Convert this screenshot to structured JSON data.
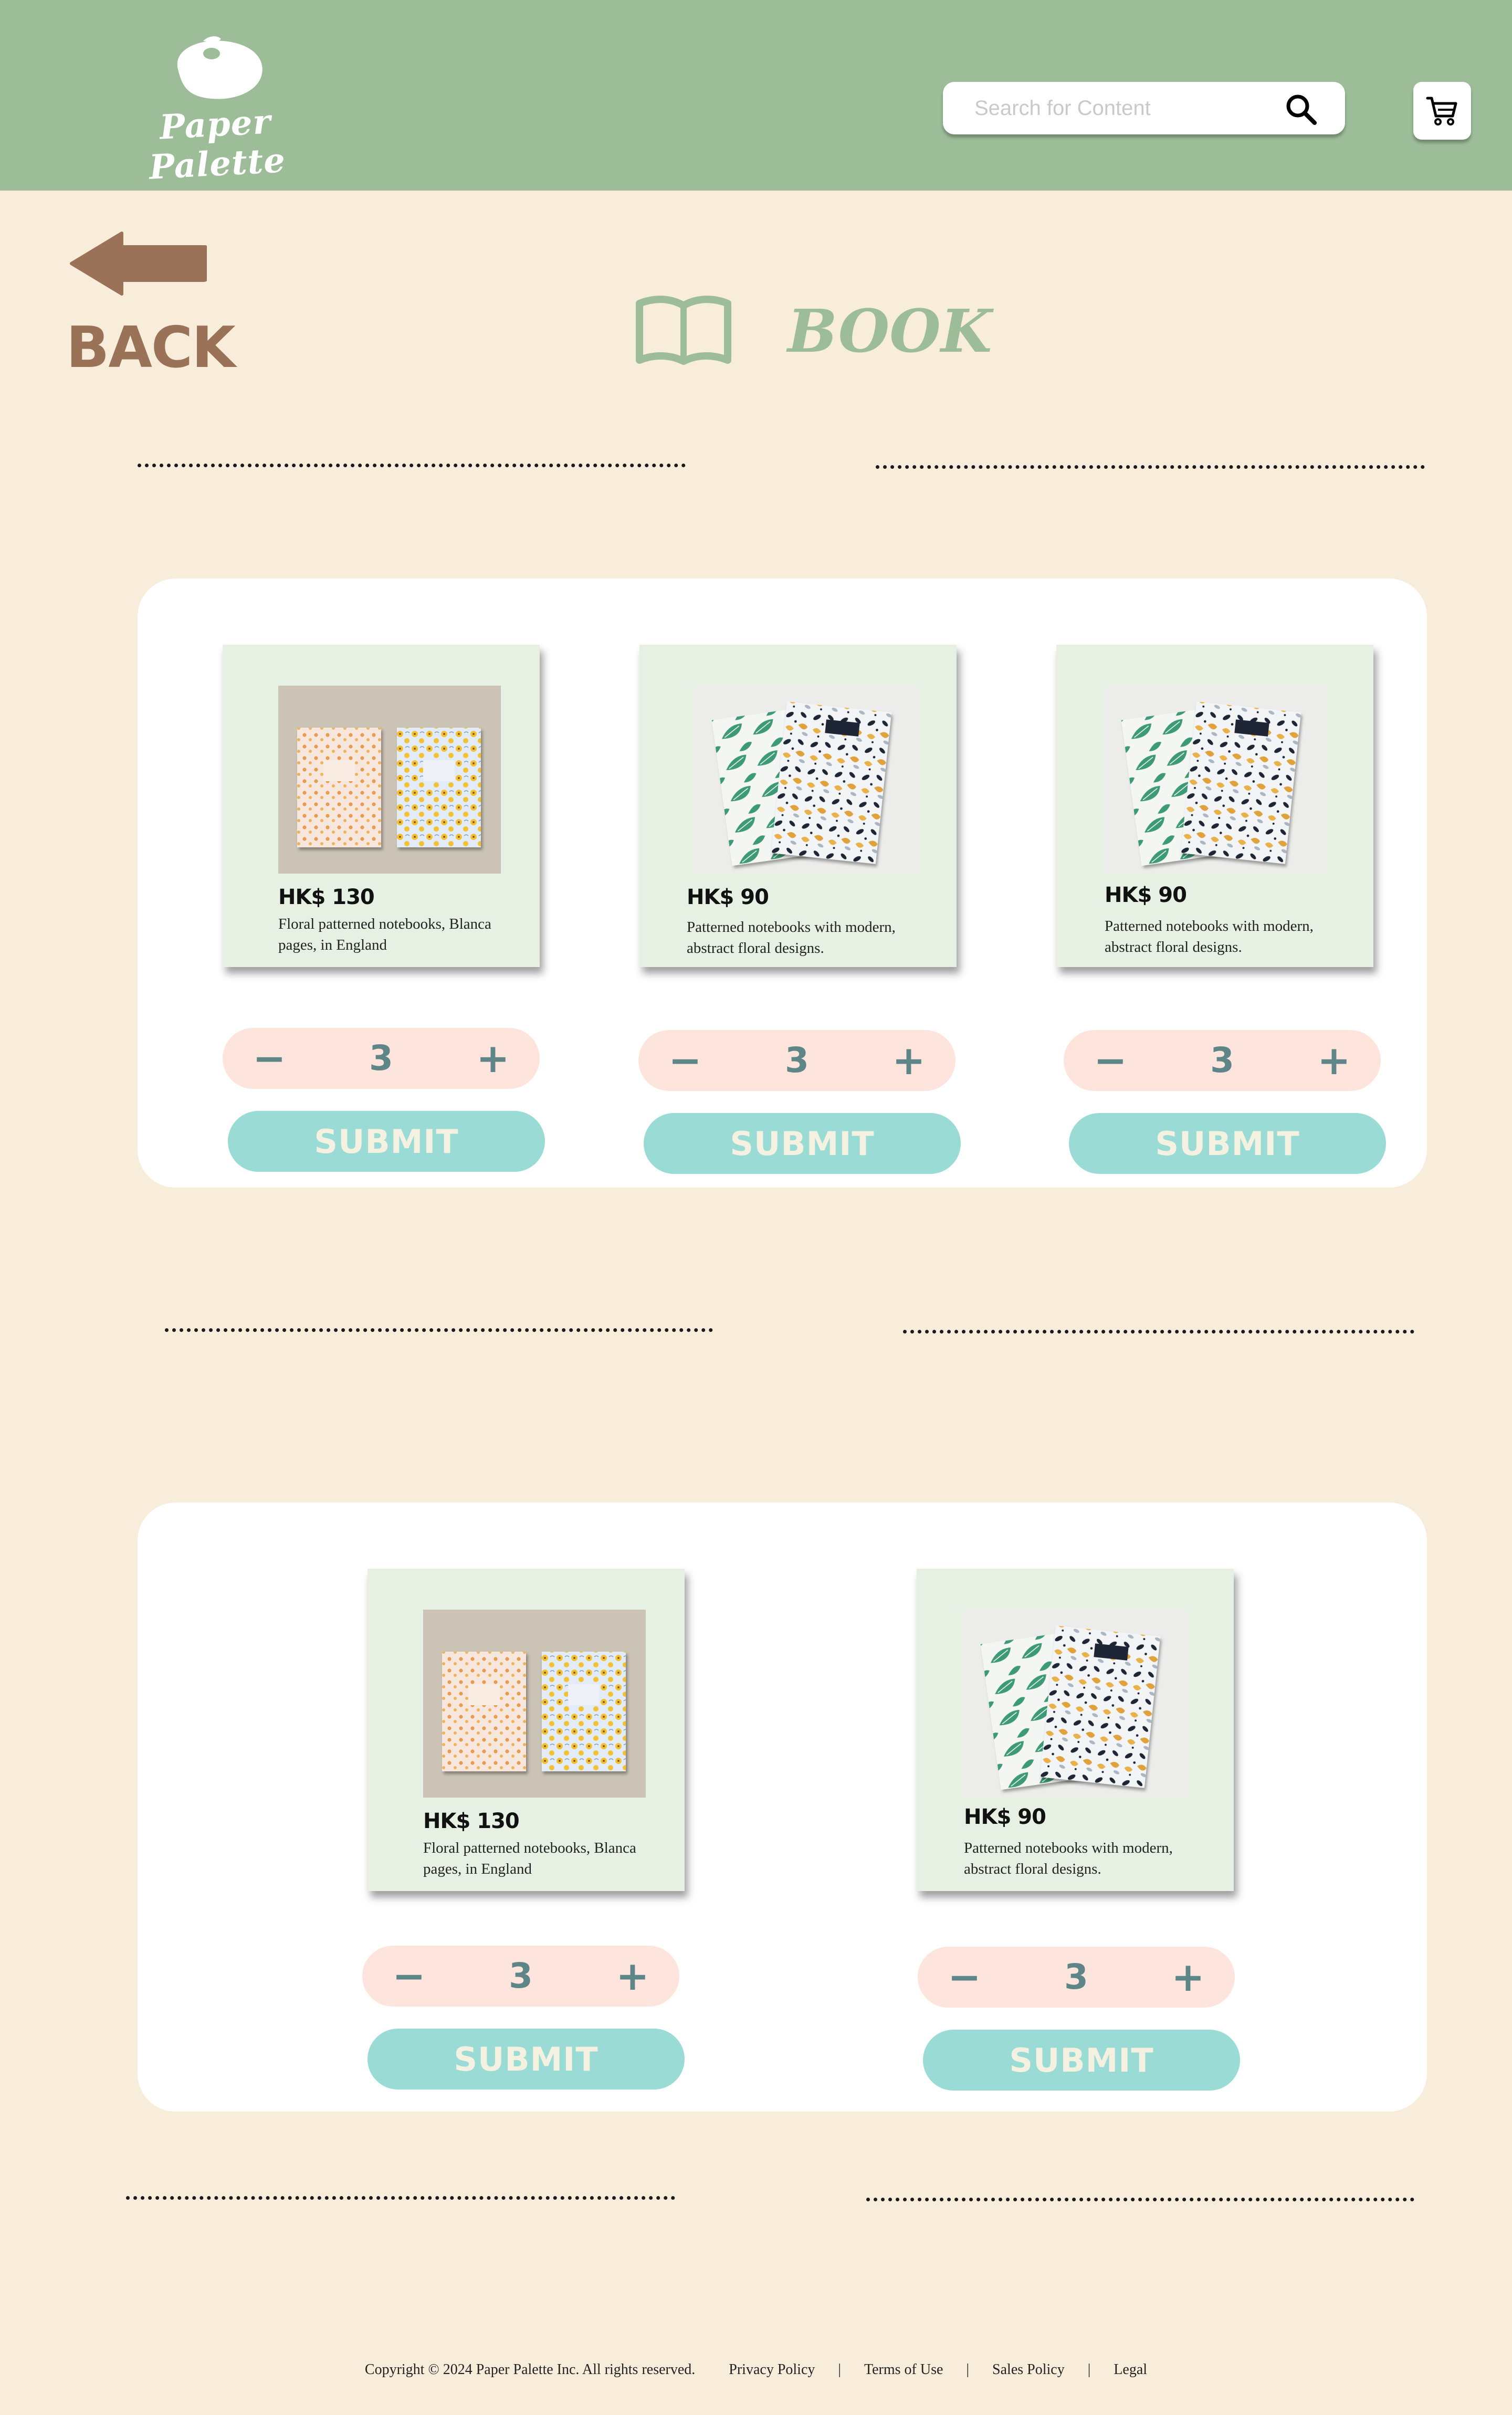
{
  "header": {
    "logo_text": "Paper Palette",
    "search_placeholder": "Search for Content",
    "search_icon": "search-icon",
    "cart_icon": "cart-icon",
    "background": "#9dbd99"
  },
  "nav": {
    "back_label": "BACK",
    "page_title": "BOOK",
    "page_icon": "open-book-icon"
  },
  "sections": [
    {
      "products": [
        {
          "price": "HK$ 130",
          "description": "Floral patterned notebooks, Blanca pages, in England",
          "image": "floral-notebooks",
          "quantity": "3",
          "minus": "−",
          "plus": "+",
          "submit": "SUBMIT"
        },
        {
          "price": "HK$ 90",
          "description": "Patterned notebooks with modern, abstract floral designs.",
          "image": "abstract-floral-notebooks",
          "quantity": "3",
          "minus": "−",
          "plus": "+",
          "submit": "SUBMIT"
        },
        {
          "price": "HK$ 90",
          "description": "Patterned notebooks with modern, abstract floral designs.",
          "image": "abstract-floral-notebooks",
          "quantity": "3",
          "minus": "−",
          "plus": "+",
          "submit": "SUBMIT"
        }
      ]
    },
    {
      "products": [
        {
          "price": "HK$ 130",
          "description": "Floral patterned notebooks, Blanca pages, in England",
          "image": "floral-notebooks",
          "quantity": "3",
          "minus": "−",
          "plus": "+",
          "submit": "SUBMIT"
        },
        {
          "price": "HK$ 90",
          "description": "Patterned notebooks with modern, abstract floral designs.",
          "image": "abstract-floral-notebooks",
          "quantity": "3",
          "minus": "−",
          "plus": "+",
          "submit": "SUBMIT"
        }
      ]
    }
  ],
  "footer": {
    "copyright": "Copyright © 2024 Paper Palette Inc. All rights reserved.",
    "links": [
      "Privacy Policy",
      "Terms of Use",
      "Sales Policy",
      "Legal"
    ],
    "separator": "|"
  },
  "colors": {
    "page_bg": "#f8eddb",
    "header_bg": "#9dbd99",
    "back": "#9a7258",
    "title": "#9dbd99",
    "card_bg": "#e6f0e3",
    "stepper_bg": "#fde4dc",
    "stepper_text": "#5e8588",
    "submit_bg": "#9adbd6",
    "submit_text": "#f4f1e1"
  }
}
